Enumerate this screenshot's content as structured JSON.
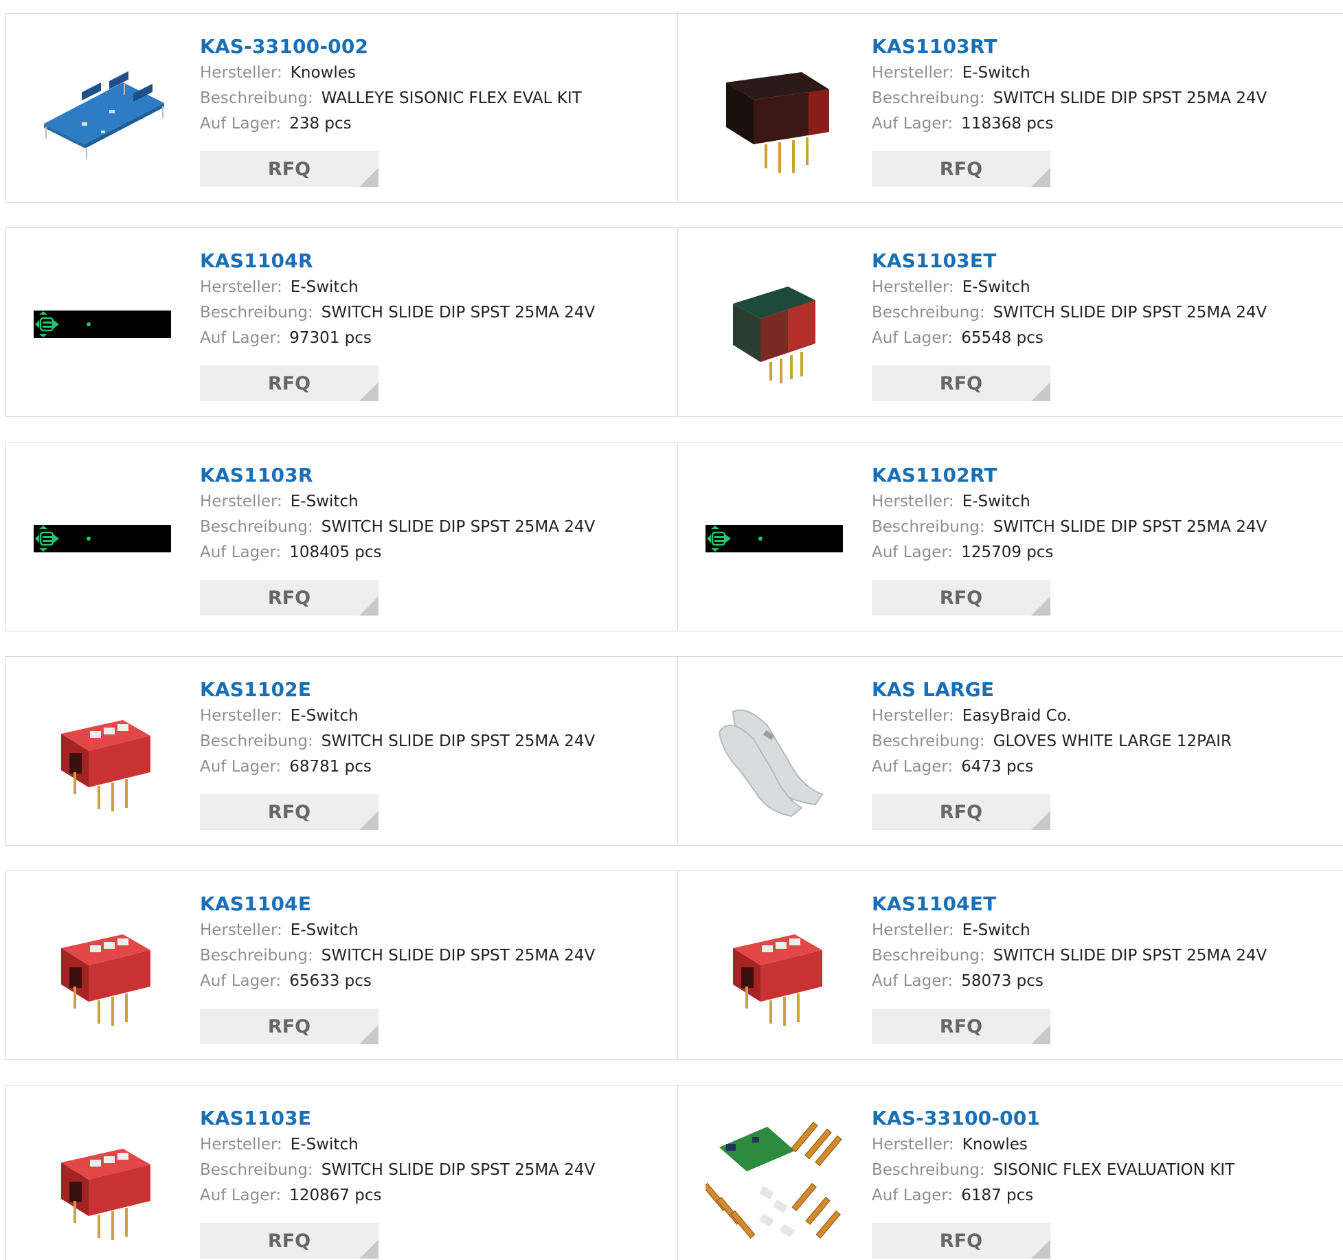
{
  "products": [
    {
      "title": "KAS-33100-002",
      "manufacturer": "Knowles",
      "description": "WALLEYE SISONIC FLEX EVAL KIT",
      "stock": "238 pcs",
      "image": "eval-board-image"
    },
    {
      "title": "KAS1103RT",
      "manufacturer": "E-Switch",
      "description": "SWITCH SLIDE DIP SPST 25MA 24V",
      "stock": "118368 pcs",
      "image": "black-dip-switch-image"
    },
    {
      "title": "KAS1104R",
      "manufacturer": "E-Switch",
      "description": "SWITCH SLIDE DIP SPST 25MA 24V",
      "stock": "97301 pcs",
      "image": "placeholder-image"
    },
    {
      "title": "KAS1103ET",
      "manufacturer": "E-Switch",
      "description": "SWITCH SLIDE DIP SPST 25MA 24V",
      "stock": "65548 pcs",
      "image": "dark-green-dip-switch-image"
    },
    {
      "title": "KAS1103R",
      "manufacturer": "E-Switch",
      "description": "SWITCH SLIDE DIP SPST 25MA 24V",
      "stock": "108405 pcs",
      "image": "placeholder-image"
    },
    {
      "title": "KAS1102RT",
      "manufacturer": "E-Switch",
      "description": "SWITCH SLIDE DIP SPST 25MA 24V",
      "stock": "125709 pcs",
      "image": "placeholder-image"
    },
    {
      "title": "KAS1102E",
      "manufacturer": "E-Switch",
      "description": "SWITCH SLIDE DIP SPST 25MA 24V",
      "stock": "68781 pcs",
      "image": "red-dip-switch-image"
    },
    {
      "title": "KAS LARGE",
      "manufacturer": "EasyBraid Co.",
      "description": "GLOVES WHITE LARGE 12PAIR",
      "stock": "6473 pcs",
      "image": "gloves-image"
    },
    {
      "title": "KAS1104E",
      "manufacturer": "E-Switch",
      "description": "SWITCH SLIDE DIP SPST 25MA 24V",
      "stock": "65633 pcs",
      "image": "red-dip-switch-image"
    },
    {
      "title": "KAS1104ET",
      "manufacturer": "E-Switch",
      "description": "SWITCH SLIDE DIP SPST 25MA 24V",
      "stock": "58073 pcs",
      "image": "red-dip-switch-image"
    },
    {
      "title": "KAS1103E",
      "manufacturer": "E-Switch",
      "description": "SWITCH SLIDE DIP SPST 25MA 24V",
      "stock": "120867 pcs",
      "image": "red-dip-switch-image"
    },
    {
      "title": "KAS-33100-001",
      "manufacturer": "Knowles",
      "description": "SISONIC FLEX EVALUATION KIT",
      "stock": "6187 pcs",
      "image": "eval-kit-image"
    }
  ],
  "labels": {
    "manufacturer": "Hersteller:",
    "description": "Beschreibung:",
    "stock": "Auf Lager:",
    "rfq": "RFQ"
  },
  "colors": {
    "title_link": "#1a6eb4",
    "label_grey": "#8f8f8f",
    "rfq_background": "#eeeeee",
    "border": "#d6d6d6"
  }
}
